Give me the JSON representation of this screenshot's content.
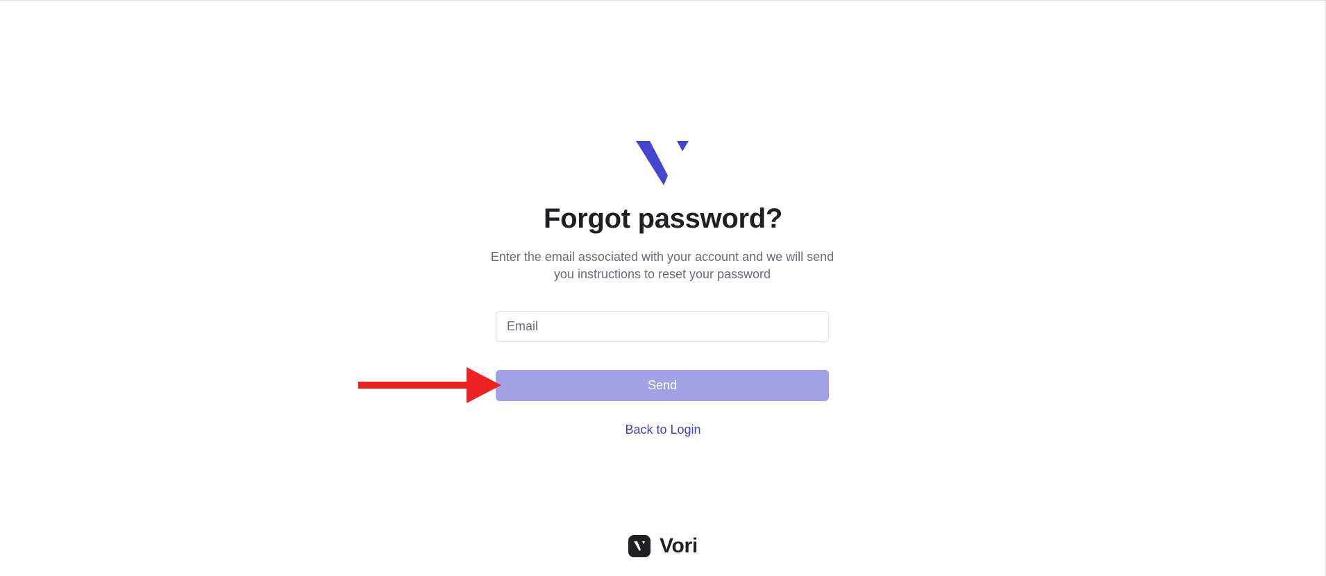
{
  "page": {
    "title": "Forgot password?",
    "subtitle": "Enter the email associated with your account and we will send you instructions to reset your password"
  },
  "form": {
    "email_placeholder": "Email",
    "email_value": "",
    "send_label": "Send",
    "back_link_label": "Back to Login"
  },
  "footer": {
    "brand_name": "Vori"
  },
  "icons": {
    "logo": "vori-v-logo-icon",
    "brand_badge": "vori-badge-icon",
    "annotation": "red-arrow-icon"
  },
  "colors": {
    "brand": "#4446cf",
    "send_button": "#a0a2e5",
    "link": "#3d3fcb",
    "annotation": "#ee2222",
    "text_primary": "#1f1f24",
    "text_secondary": "#6b6b78"
  }
}
